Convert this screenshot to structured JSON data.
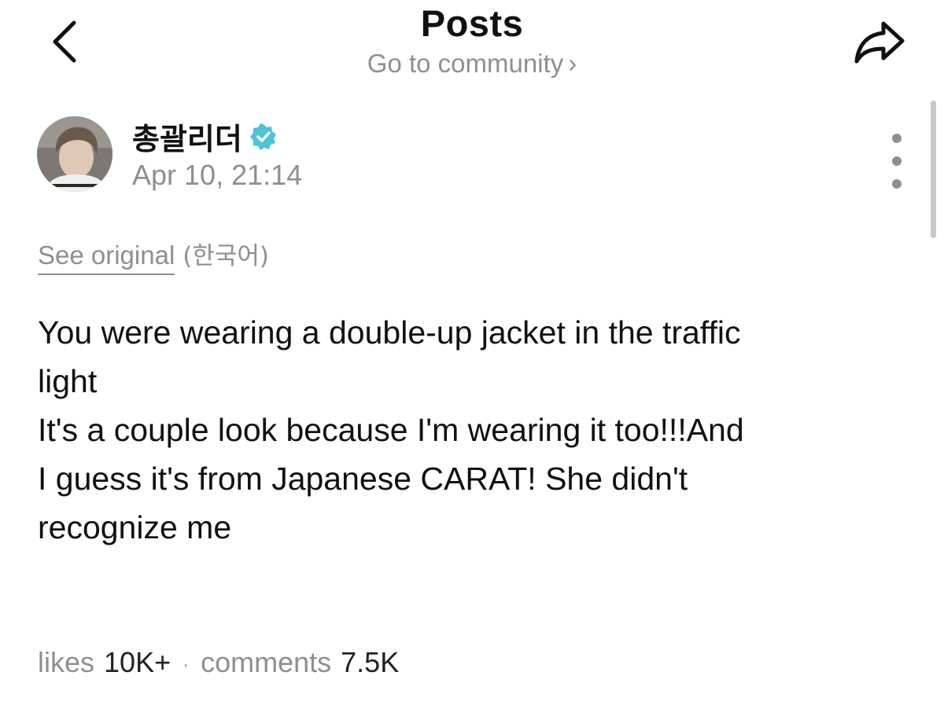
{
  "header": {
    "title": "Posts",
    "community_link": "Go to community",
    "community_chevron": "›",
    "back_icon": "chevron-left-icon",
    "share_icon": "share-arrow-icon"
  },
  "post": {
    "author": "총괄리더",
    "verified": true,
    "verified_color": "#4fc3d9",
    "date": "Apr 10, 21:14",
    "see_original": "See original",
    "original_language": "(한국어)",
    "body_lines": [
      "You were wearing a double-up jacket in the traffic",
      "light",
      "It's a couple look because I'm wearing it too!!!And",
      "I guess it's from Japanese CARAT! She didn't",
      "recognize me"
    ],
    "more_icon": "more-vertical-icon"
  },
  "stats": {
    "likes_label": "likes",
    "likes_value": "10K+",
    "separator": "·",
    "comments_label": "comments",
    "comments_value": "7.5K"
  }
}
